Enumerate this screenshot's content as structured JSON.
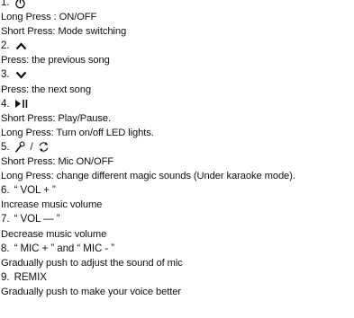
{
  "items": [
    {
      "num": "1.",
      "icon": "power-icon",
      "lines": [
        "Long Press : ON/OFF",
        "Short Press: Mode switching"
      ]
    },
    {
      "num": "2.",
      "icon": "chevron-up-icon",
      "lines": [
        "Press: the previous song"
      ]
    },
    {
      "num": "3.",
      "icon": "chevron-down-icon",
      "lines": [
        "Press: the next song"
      ]
    },
    {
      "num": "4.",
      "icon": "play-pause-icon",
      "lines": [
        "Short Press: Play/Pause.",
        "Long Press: Turn on/off LED lights."
      ]
    },
    {
      "num": "5.",
      "icon": "mic-and-cycle-icon",
      "sep": "/",
      "lines": [
        "Short Press: Mic ON/OFF",
        "Long Press: change different magic sounds (Under karaoke mode)."
      ]
    },
    {
      "num": "6.",
      "label": "“ VOL  +  ”",
      "lines": [
        "Increase music volume"
      ]
    },
    {
      "num": "7.",
      "label": "“ VOL  —  ”",
      "lines": [
        "Decrease music volume"
      ]
    },
    {
      "num": "8.",
      "label": "“ MIC + ” and “ MIC - ”",
      "lines": [
        "Gradually push to adjust the sound of mic"
      ]
    },
    {
      "num": "9.",
      "label": "REMIX",
      "lines": [
        "Gradually push to make your voice better"
      ]
    }
  ]
}
